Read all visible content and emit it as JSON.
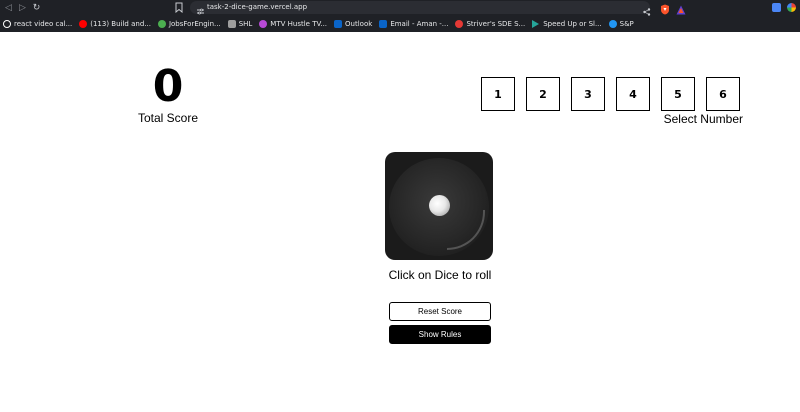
{
  "browser": {
    "url": "task-2-dice-game.vercel.app",
    "bookmarks": [
      {
        "label": "react video cal...",
        "icon": "github-icon",
        "color": "#ffffff"
      },
      {
        "label": "(113) Build and...",
        "icon": "youtube-icon",
        "color": "#ff0000"
      },
      {
        "label": "JobsForEngin...",
        "icon": "jobs-icon",
        "color": "#4caf50"
      },
      {
        "label": "SHL",
        "icon": "shl-icon",
        "color": "#9e9e9e"
      },
      {
        "label": "MTV Hustle TV...",
        "icon": "mtv-icon",
        "color": "#b84ad6"
      },
      {
        "label": "Outlook",
        "icon": "outlook-icon",
        "color": "#0a64c8"
      },
      {
        "label": "Email - Aman -...",
        "icon": "email-icon",
        "color": "#0a64c8"
      },
      {
        "label": "Striver's SDE S...",
        "icon": "striver-icon",
        "color": "#e53935"
      },
      {
        "label": "Speed Up or Sl...",
        "icon": "play-icon",
        "color": "#26a69a"
      },
      {
        "label": "S&P",
        "icon": "sp-icon",
        "color": "#2196f3"
      }
    ]
  },
  "game": {
    "total_score": "0",
    "total_score_label": "Total Score",
    "numbers": [
      "1",
      "2",
      "3",
      "4",
      "5",
      "6"
    ],
    "select_label": "Select Number",
    "dice_hint": "Click on Dice to roll",
    "reset_label": "Reset Score",
    "rules_label": "Show Rules"
  }
}
